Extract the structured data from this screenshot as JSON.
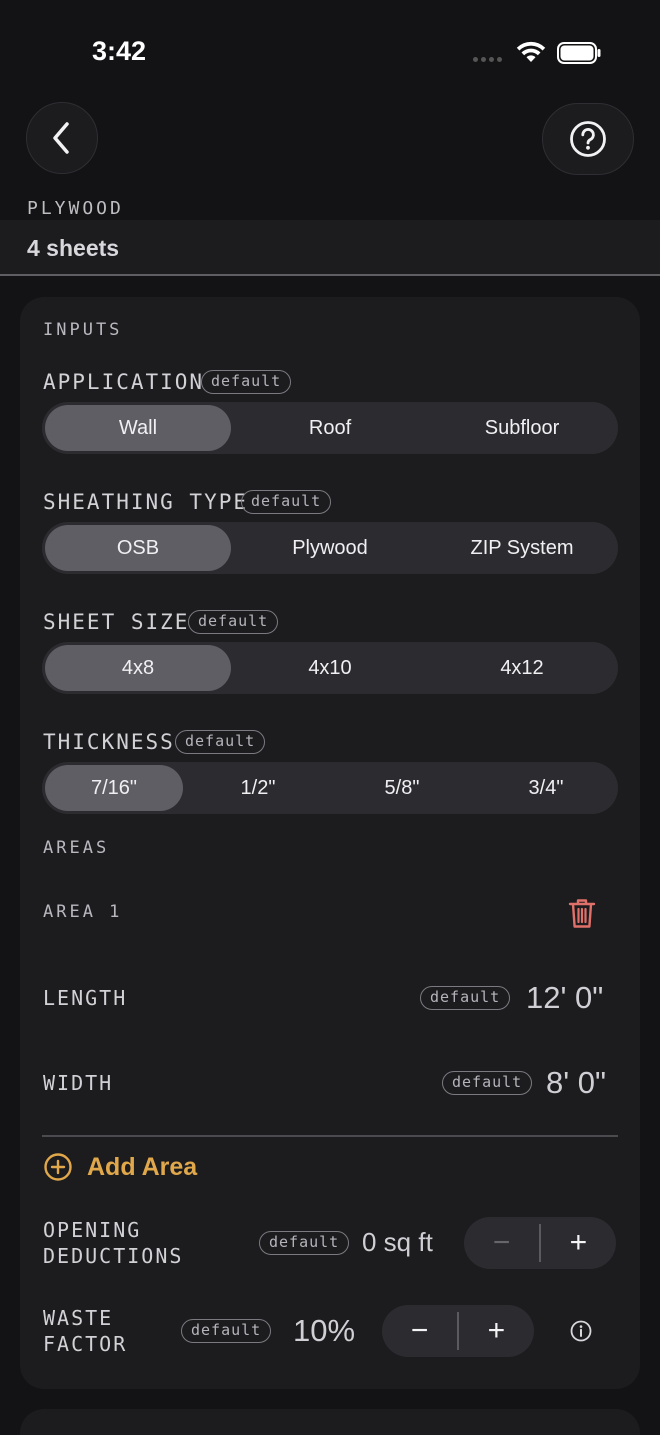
{
  "status": {
    "time": "3:42"
  },
  "nav": {
    "back_icon": "chevron-left-icon",
    "help_icon": "question-circle-icon"
  },
  "material": {
    "label": "PLYWOOD",
    "result": "4 sheets"
  },
  "inputs": {
    "section_label": "INPUTS",
    "default_badge": "default",
    "application": {
      "label": "APPLICATION",
      "options": [
        "Wall",
        "Roof",
        "Subfloor"
      ],
      "selected": "Wall"
    },
    "sheathing_type": {
      "label": "SHEATHING TYPE",
      "options": [
        "OSB",
        "Plywood",
        "ZIP System"
      ],
      "selected": "OSB"
    },
    "sheet_size": {
      "label": "SHEET SIZE",
      "options": [
        "4x8",
        "4x10",
        "4x12"
      ],
      "selected": "4x8"
    },
    "thickness": {
      "label": "THICKNESS",
      "options": [
        "7/16\"",
        "1/2\"",
        "5/8\"",
        "3/4\""
      ],
      "selected": "7/16\""
    }
  },
  "areas": {
    "section_label": "AREAS",
    "items": [
      {
        "title": "AREA 1",
        "length_label": "LENGTH",
        "length_value": "12' 0\"",
        "width_label": "WIDTH",
        "width_value": "8' 0\""
      }
    ],
    "add_label": "Add Area"
  },
  "opening_deductions": {
    "label_line1": "OPENING",
    "label_line2": "DEDUCTIONS",
    "value": "0 sq ft",
    "minus": "−",
    "plus": "+"
  },
  "waste_factor": {
    "label_line1": "WASTE",
    "label_line2": "FACTOR",
    "value": "10%",
    "minus": "−",
    "plus": "+"
  },
  "colors": {
    "accent": "#e0a84a",
    "delete": "#e0706a",
    "background": "#131315",
    "card": "#1c1c1f"
  }
}
